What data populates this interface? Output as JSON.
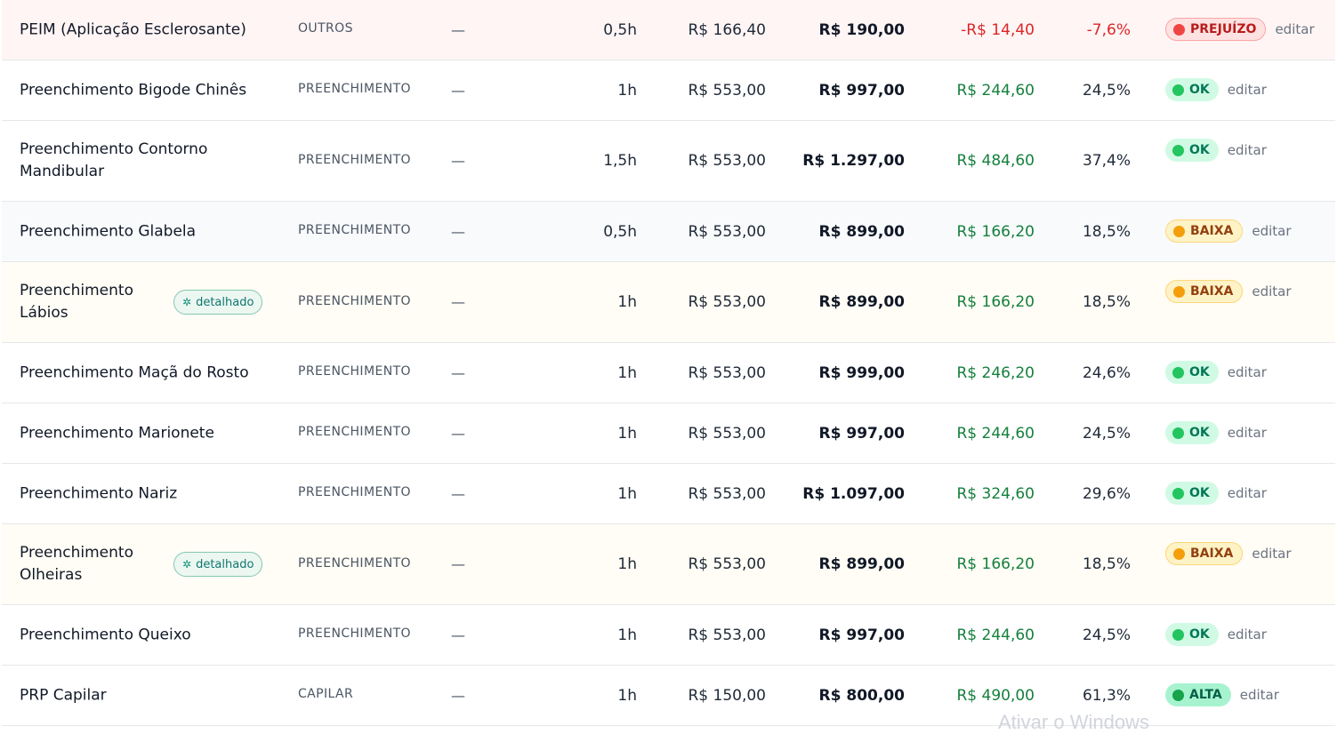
{
  "rows": [
    {
      "name": "PEIM (Aplicação Esclerosante)",
      "category": "OUTROS",
      "dash": "—",
      "hours": "0,5h",
      "cost": "R$ 166,40",
      "price": "R$ 190,00",
      "profit": "-R$ 14,40",
      "margin": "-7,6%",
      "status": "PREJUÍZO",
      "edit": "editar",
      "detail": ""
    },
    {
      "name": "Preenchimento Bigode Chinês",
      "category": "PREENCHIMENTO",
      "dash": "—",
      "hours": "1h",
      "cost": "R$ 553,00",
      "price": "R$ 997,00",
      "profit": "R$ 244,60",
      "margin": "24,5%",
      "status": "OK",
      "edit": "editar",
      "detail": ""
    },
    {
      "name": "Preenchimento Contorno Mandibular",
      "category": "PREENCHIMENTO",
      "dash": "—",
      "hours": "1,5h",
      "cost": "R$ 553,00",
      "price": "R$ 1.297,00",
      "profit": "R$ 484,60",
      "margin": "37,4%",
      "status": "OK",
      "edit": "editar",
      "detail": ""
    },
    {
      "name": "Preenchimento Glabela",
      "category": "PREENCHIMENTO",
      "dash": "—",
      "hours": "0,5h",
      "cost": "R$ 553,00",
      "price": "R$ 899,00",
      "profit": "R$ 166,20",
      "margin": "18,5%",
      "status": "BAIXA",
      "edit": "editar",
      "detail": ""
    },
    {
      "name": "Preenchimento Lábios",
      "category": "PREENCHIMENTO",
      "dash": "—",
      "hours": "1h",
      "cost": "R$ 553,00",
      "price": "R$ 899,00",
      "profit": "R$ 166,20",
      "margin": "18,5%",
      "status": "BAIXA",
      "edit": "editar",
      "detail": "detalhado"
    },
    {
      "name": "Preenchimento Maçã do Rosto",
      "category": "PREENCHIMENTO",
      "dash": "—",
      "hours": "1h",
      "cost": "R$ 553,00",
      "price": "R$ 999,00",
      "profit": "R$ 246,20",
      "margin": "24,6%",
      "status": "OK",
      "edit": "editar",
      "detail": ""
    },
    {
      "name": "Preenchimento Marionete",
      "category": "PREENCHIMENTO",
      "dash": "—",
      "hours": "1h",
      "cost": "R$ 553,00",
      "price": "R$ 997,00",
      "profit": "R$ 244,60",
      "margin": "24,5%",
      "status": "OK",
      "edit": "editar",
      "detail": ""
    },
    {
      "name": "Preenchimento Nariz",
      "category": "PREENCHIMENTO",
      "dash": "—",
      "hours": "1h",
      "cost": "R$ 553,00",
      "price": "R$ 1.097,00",
      "profit": "R$ 324,60",
      "margin": "29,6%",
      "status": "OK",
      "edit": "editar",
      "detail": ""
    },
    {
      "name": "Preenchimento Olheiras",
      "category": "PREENCHIMENTO",
      "dash": "—",
      "hours": "1h",
      "cost": "R$ 553,00",
      "price": "R$ 899,00",
      "profit": "R$ 166,20",
      "margin": "18,5%",
      "status": "BAIXA",
      "edit": "editar",
      "detail": "detalhado"
    },
    {
      "name": "Preenchimento Queixo",
      "category": "PREENCHIMENTO",
      "dash": "—",
      "hours": "1h",
      "cost": "R$ 553,00",
      "price": "R$ 997,00",
      "profit": "R$ 244,60",
      "margin": "24,5%",
      "status": "OK",
      "edit": "editar",
      "detail": ""
    },
    {
      "name": "PRP Capilar",
      "category": "CAPILAR",
      "dash": "—",
      "hours": "1h",
      "cost": "R$ 150,00",
      "price": "R$ 800,00",
      "profit": "R$ 490,00",
      "margin": "61,3%",
      "status": "ALTA",
      "edit": "editar",
      "detail": ""
    }
  ],
  "watermark": "Ativar o Windows"
}
